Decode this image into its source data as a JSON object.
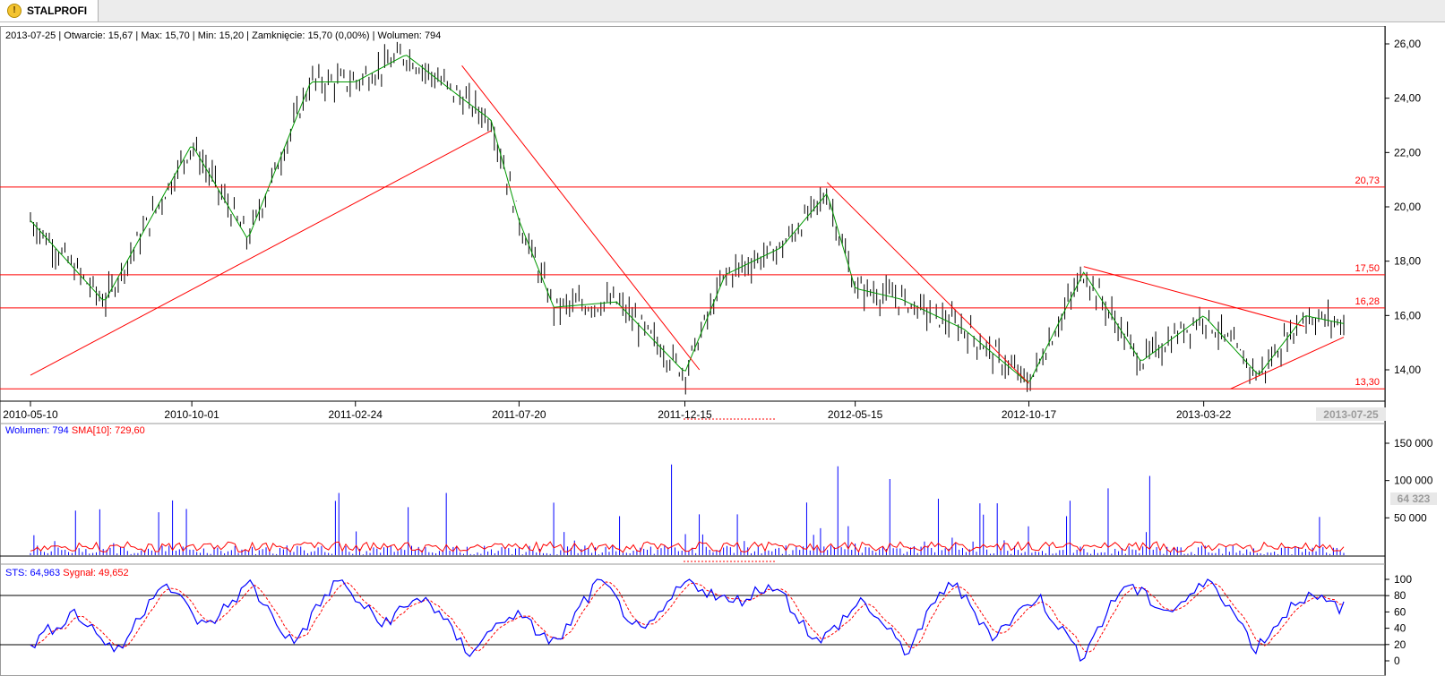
{
  "tab": {
    "label": "STALPROFI",
    "icon": "warning-icon"
  },
  "info": {
    "date": "2013-07-25",
    "open_label": "Otwarcie:",
    "open": "15,67",
    "max_label": "Max:",
    "max": "15,70",
    "min_label": "Min:",
    "min": "15,20",
    "close_label": "Zamknięcie:",
    "close": "15,70 (0,00%)",
    "volume_label": "Wolumen:",
    "volume": "794"
  },
  "price_panel": {
    "y_ticks": [
      "26,00",
      "24,00",
      "22,00",
      "20,00",
      "18,00",
      "16,00",
      "14,00"
    ],
    "levels": [
      {
        "value": 20.73,
        "label": "20,73"
      },
      {
        "value": 17.5,
        "label": "17,50"
      },
      {
        "value": 16.28,
        "label": "16,28"
      },
      {
        "value": 13.3,
        "label": "13,30"
      }
    ]
  },
  "date_axis": {
    "ticks": [
      "2010-05-10",
      "2010-10-01",
      "2011-02-24",
      "2011-07-20",
      "2011-12-15",
      "2012-05-15",
      "2012-10-17",
      "2013-03-22"
    ],
    "current": "2013-07-25"
  },
  "volume_panel": {
    "label": "Wolumen:",
    "value": "794",
    "sma_label": "SMA[10]:",
    "sma_value": "729,60",
    "y_ticks": [
      "150 000",
      "100 000",
      "50 000"
    ],
    "current": "64 323"
  },
  "stoch_panel": {
    "sts_label": "STS:",
    "sts_value": "64,963",
    "signal_label": "Sygnał:",
    "signal_value": "49,652",
    "y_ticks": [
      "100",
      "80",
      "60",
      "40",
      "20",
      "0"
    ]
  },
  "colors": {
    "trend": "#ff0000",
    "sma": "#009900",
    "candle": "#000000",
    "volume": "#0000ff",
    "volume_sma": "#ff0000",
    "sts": "#0000ff",
    "signal": "#ff0000"
  },
  "chart_data": [
    {
      "type": "line",
      "y_range": [
        13.3,
        26.0
      ],
      "x_range": [
        "2010-05-10",
        "2013-07-25"
      ],
      "series": [
        {
          "name": "",
          "x": [
            "2010-05-10",
            "2010-07-15",
            "2010-10-01",
            "2010-11-20",
            "2011-01-15",
            "2011-02-24",
            "2011-04-10",
            "2011-05-30",
            "2011-06-25",
            "2011-07-20",
            "2011-08-20",
            "2011-10-15",
            "2011-12-15",
            "2012-01-20",
            "2012-03-10",
            "2012-04-20",
            "2012-05-15",
            "2012-06-25",
            "2012-08-20",
            "2012-10-17",
            "2012-12-05",
            "2013-01-25",
            "2013-03-22",
            "2013-05-10",
            "2013-06-20",
            "2013-07-25"
          ],
          "values": [
            19.5,
            16.5,
            22.3,
            18.8,
            24.6,
            24.6,
            25.6,
            24.0,
            23.2,
            19.5,
            16.3,
            16.5,
            13.9,
            17.5,
            18.5,
            20.5,
            17.0,
            16.6,
            15.5,
            13.5,
            17.6,
            14.3,
            16.0,
            13.8,
            16.0,
            15.7
          ]
        }
      ],
      "trendlines": [
        {
          "from": [
            "2010-05-10",
            13.8
          ],
          "to": [
            "2011-06-25",
            22.8
          ]
        },
        {
          "from": [
            "2011-05-30",
            25.2
          ],
          "to": [
            "2011-12-28",
            14.0
          ]
        },
        {
          "from": [
            "2012-04-20",
            20.9
          ],
          "to": [
            "2012-10-17",
            13.5
          ]
        },
        {
          "from": [
            "2012-12-05",
            17.8
          ],
          "to": [
            "2013-06-20",
            15.6
          ]
        },
        {
          "from": [
            "2013-04-15",
            13.3
          ],
          "to": [
            "2013-07-25",
            15.2
          ]
        }
      ]
    },
    {
      "type": "bar",
      "y_range": [
        0,
        150000
      ],
      "series": [
        {
          "name": "",
          "values": [
            18000,
            12000,
            95000,
            20000,
            150000,
            30000,
            110000,
            45000,
            95000,
            60000,
            40000,
            120000,
            25000,
            95000,
            30000,
            60000,
            35000,
            45000,
            80000,
            25000,
            105000
          ]
        }
      ]
    },
    {
      "type": "line",
      "y_range": [
        0,
        100
      ],
      "series": [
        {
          "name": "",
          "values": [
            20,
            60,
            10,
            100,
            40,
            95,
            20,
            100,
            45,
            80,
            10,
            60,
            20,
            100,
            30,
            100,
            70,
            95,
            20,
            75,
            10,
            100,
            30,
            80,
            5,
            95,
            60,
            100,
            15,
            80,
            65
          ]
        }
      ]
    }
  ]
}
